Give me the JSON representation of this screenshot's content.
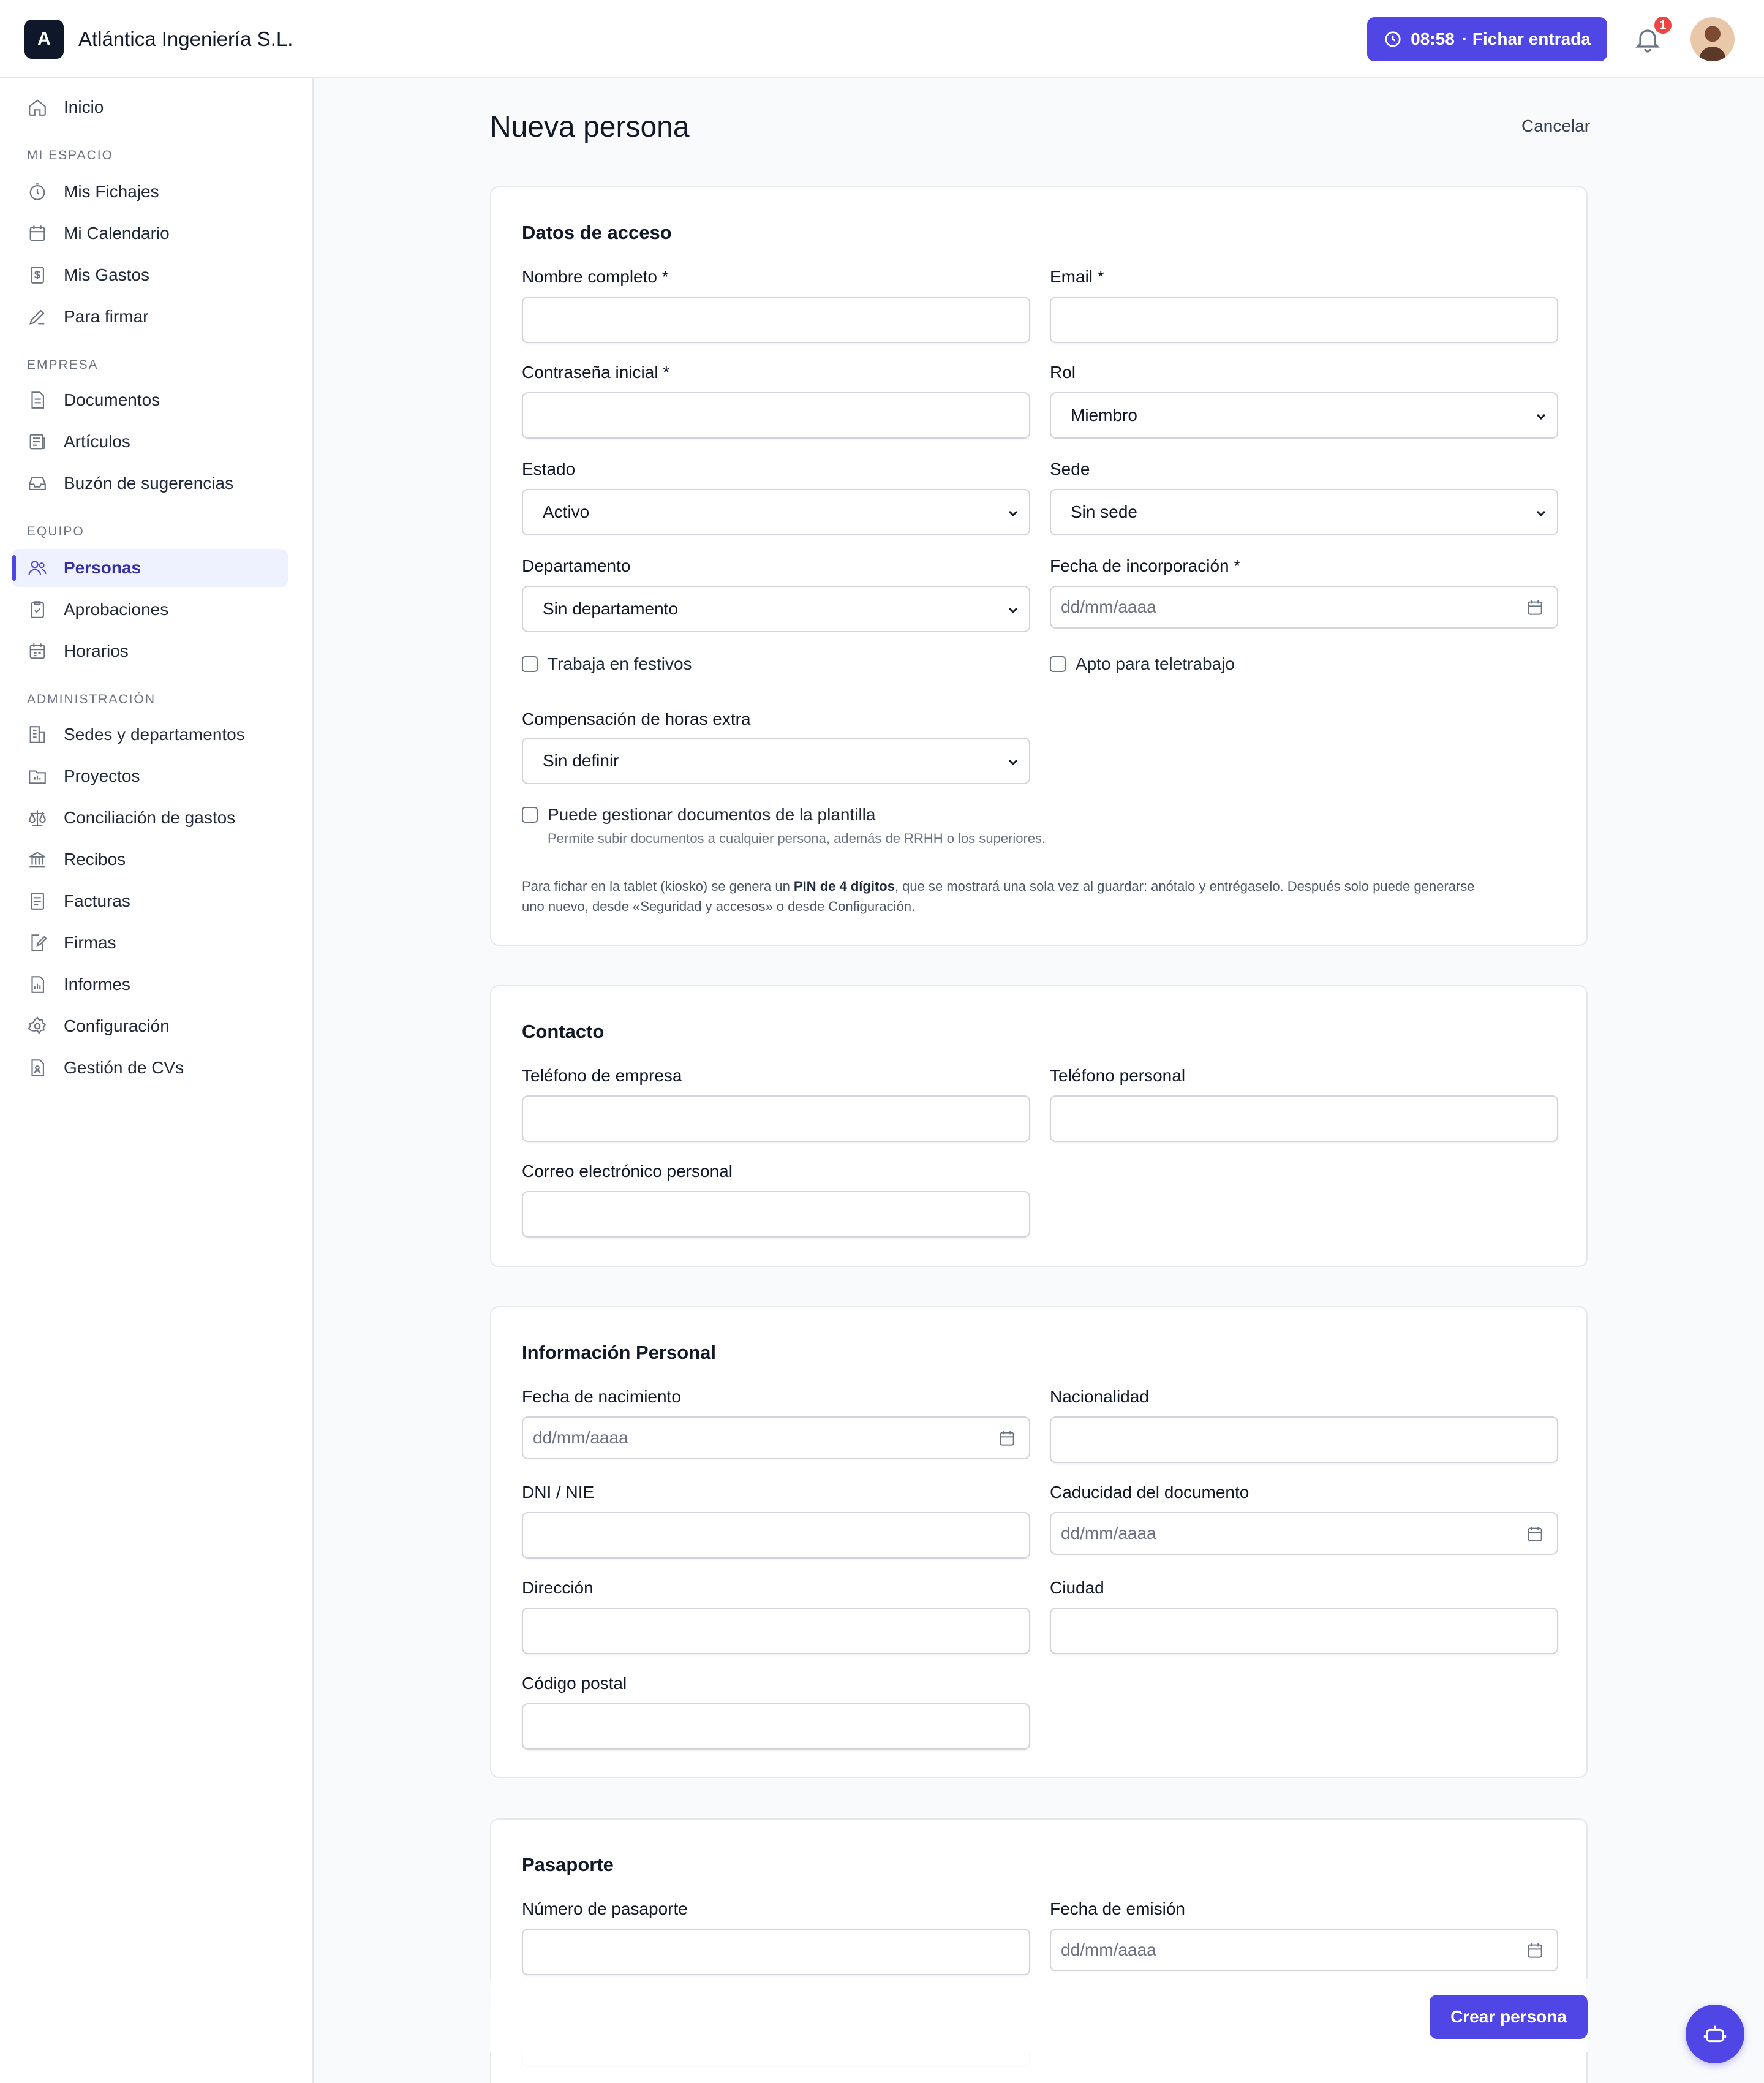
{
  "brand": {
    "logo_letter": "A",
    "name": "Atlántica Ingeniería S.L."
  },
  "header": {
    "clock_time": "08:58",
    "clock_label": "· Fichar entrada",
    "notifications_count": "1"
  },
  "sidebar": {
    "home": "Inicio",
    "sections": {
      "mi_espacio": "MI ESPACIO",
      "empresa": "EMPRESA",
      "equipo": "EQUIPO",
      "administracion": "ADMINISTRACIÓN"
    },
    "mi_espacio": [
      "Mis Fichajes",
      "Mi Calendario",
      "Mis Gastos",
      "Para firmar"
    ],
    "empresa": [
      "Documentos",
      "Artículos",
      "Buzón de sugerencias"
    ],
    "equipo": [
      "Personas",
      "Aprobaciones",
      "Horarios"
    ],
    "administracion": [
      "Sedes y departamentos",
      "Proyectos",
      "Conciliación de gastos",
      "Recibos",
      "Facturas",
      "Firmas",
      "Informes",
      "Configuración",
      "Gestión de CVs"
    ],
    "active": "Personas"
  },
  "page": {
    "title": "Nueva persona",
    "cancel": "Cancelar"
  },
  "acceso": {
    "title": "Datos de acceso",
    "nombre_label": "Nombre completo *",
    "email_label": "Email *",
    "password_label": "Contraseña inicial *",
    "rol_label": "Rol",
    "rol_value": "Miembro",
    "estado_label": "Estado",
    "estado_value": "Activo",
    "sede_label": "Sede",
    "sede_value": "Sin sede",
    "departamento_label": "Departamento",
    "departamento_value": "Sin departamento",
    "fecha_label": "Fecha de incorporación *",
    "date_placeholder": "dd/mm/aaaa",
    "festivos": "Trabaja en festivos",
    "teletrabajo": "Apto para teletrabajo",
    "compensacion_label": "Compensación de horas extra",
    "compensacion_value": "Sin definir",
    "gestionar_docs": "Puede gestionar documentos de la plantilla",
    "gestionar_help": "Permite subir documentos a cualquier persona, además de RRHH o los superiores.",
    "pin_note_1": "Para fichar en la tablet (kiosko) se genera un ",
    "pin_note_bold": "PIN de 4 dígitos",
    "pin_note_2": ", que se mostrará una sola vez al guardar: anótalo y entrégaselo. Después solo puede generarse",
    "pin_note_3": "uno nuevo, desde «Seguridad y accesos» o desde Configuración."
  },
  "contacto": {
    "title": "Contacto",
    "tel_empresa": "Teléfono de empresa",
    "tel_personal": "Teléfono personal",
    "correo_personal": "Correo electrónico personal"
  },
  "personal": {
    "title": "Información Personal",
    "nacimiento": "Fecha de nacimiento",
    "nacionalidad": "Nacionalidad",
    "dni": "DNI / NIE",
    "caducidad": "Caducidad del documento",
    "direccion": "Dirección",
    "ciudad": "Ciudad",
    "cp": "Código postal",
    "date_placeholder": "dd/mm/aaaa"
  },
  "pasaporte": {
    "title": "Pasaporte",
    "numero": "Número de pasaporte",
    "emision": "Fecha de emisión",
    "date_placeholder": "dd/mm/aaaa"
  },
  "actions": {
    "create": "Crear persona"
  },
  "colors": {
    "accent": "#4f46e5",
    "badge": "#ef4444",
    "brand_dark": "#0f172a"
  }
}
